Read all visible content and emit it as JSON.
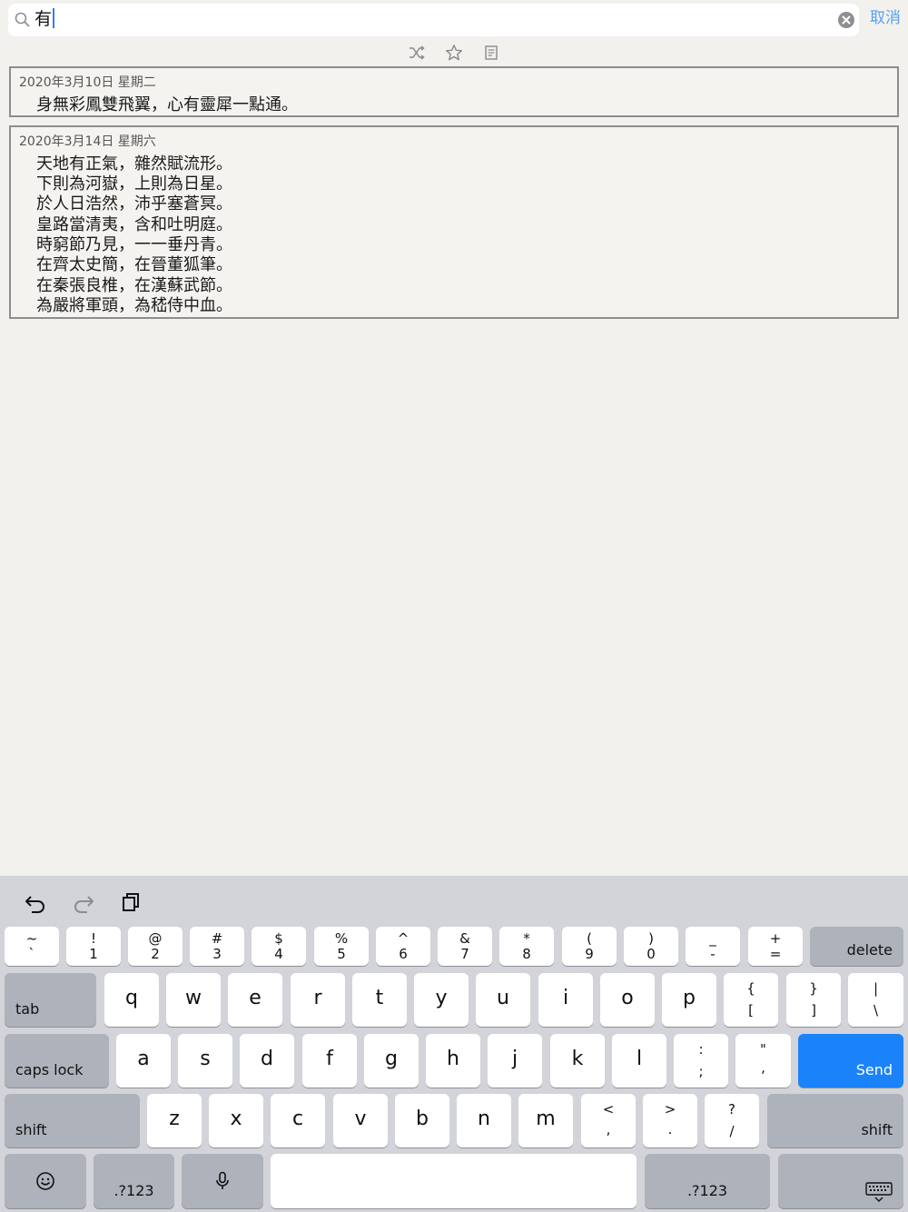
{
  "search": {
    "value": "有",
    "cancel_label": "取消"
  },
  "toolbar": {
    "icons": [
      "shuffle-icon",
      "star-icon",
      "document-icon"
    ]
  },
  "entries": [
    {
      "date": "2020年3月10日 星期二",
      "lines": [
        "身無彩鳳雙飛翼，心有靈犀一點通。"
      ]
    },
    {
      "date": "2020年3月14日 星期六",
      "lines": [
        "天地有正氣，雜然賦流形。",
        "下則為河嶽，上則為日星。",
        "於人日浩然，沛乎塞蒼冥。",
        "皇路當清夷，含和吐明庭。",
        "時窮節乃見，一一垂丹青。",
        "在齊太史簡，在晉董狐筆。",
        "在秦張良椎，在漢蘇武節。",
        "為嚴將軍頭，為嵇侍中血。"
      ]
    }
  ],
  "keyboard": {
    "number_row": [
      {
        "top": "~",
        "bottom": "`"
      },
      {
        "top": "!",
        "bottom": "1"
      },
      {
        "top": "@",
        "bottom": "2"
      },
      {
        "top": "#",
        "bottom": "3"
      },
      {
        "top": "$",
        "bottom": "4"
      },
      {
        "top": "%",
        "bottom": "5"
      },
      {
        "top": "^",
        "bottom": "6"
      },
      {
        "top": "&",
        "bottom": "7"
      },
      {
        "top": "*",
        "bottom": "8"
      },
      {
        "top": "(",
        "bottom": "9"
      },
      {
        "top": ")",
        "bottom": "0"
      },
      {
        "top": "_",
        "bottom": "-"
      },
      {
        "top": "+",
        "bottom": "="
      }
    ],
    "delete_label": "delete",
    "tab_label": "tab",
    "row_q": [
      "q",
      "w",
      "e",
      "r",
      "t",
      "y",
      "u",
      "i",
      "o",
      "p"
    ],
    "row_q_symbols": [
      {
        "top": "{",
        "bottom": "["
      },
      {
        "top": "}",
        "bottom": "]"
      },
      {
        "top": "|",
        "bottom": "\\"
      }
    ],
    "caps_label": "caps lock",
    "row_a": [
      "a",
      "s",
      "d",
      "f",
      "g",
      "h",
      "j",
      "k",
      "l"
    ],
    "row_a_symbols": [
      {
        "top": ":",
        "bottom": ";"
      },
      {
        "top": "\"",
        "bottom": ","
      }
    ],
    "send_label": "Send",
    "shift_label": "shift",
    "row_z": [
      "z",
      "x",
      "c",
      "v",
      "b",
      "n",
      "m"
    ],
    "row_z_symbols": [
      {
        "top": "<",
        "bottom": ","
      },
      {
        "top": ">",
        "bottom": "."
      },
      {
        "top": "?",
        "bottom": "/"
      }
    ],
    "numbers_label": ".?123",
    "accent_color": "#1a82fb"
  }
}
